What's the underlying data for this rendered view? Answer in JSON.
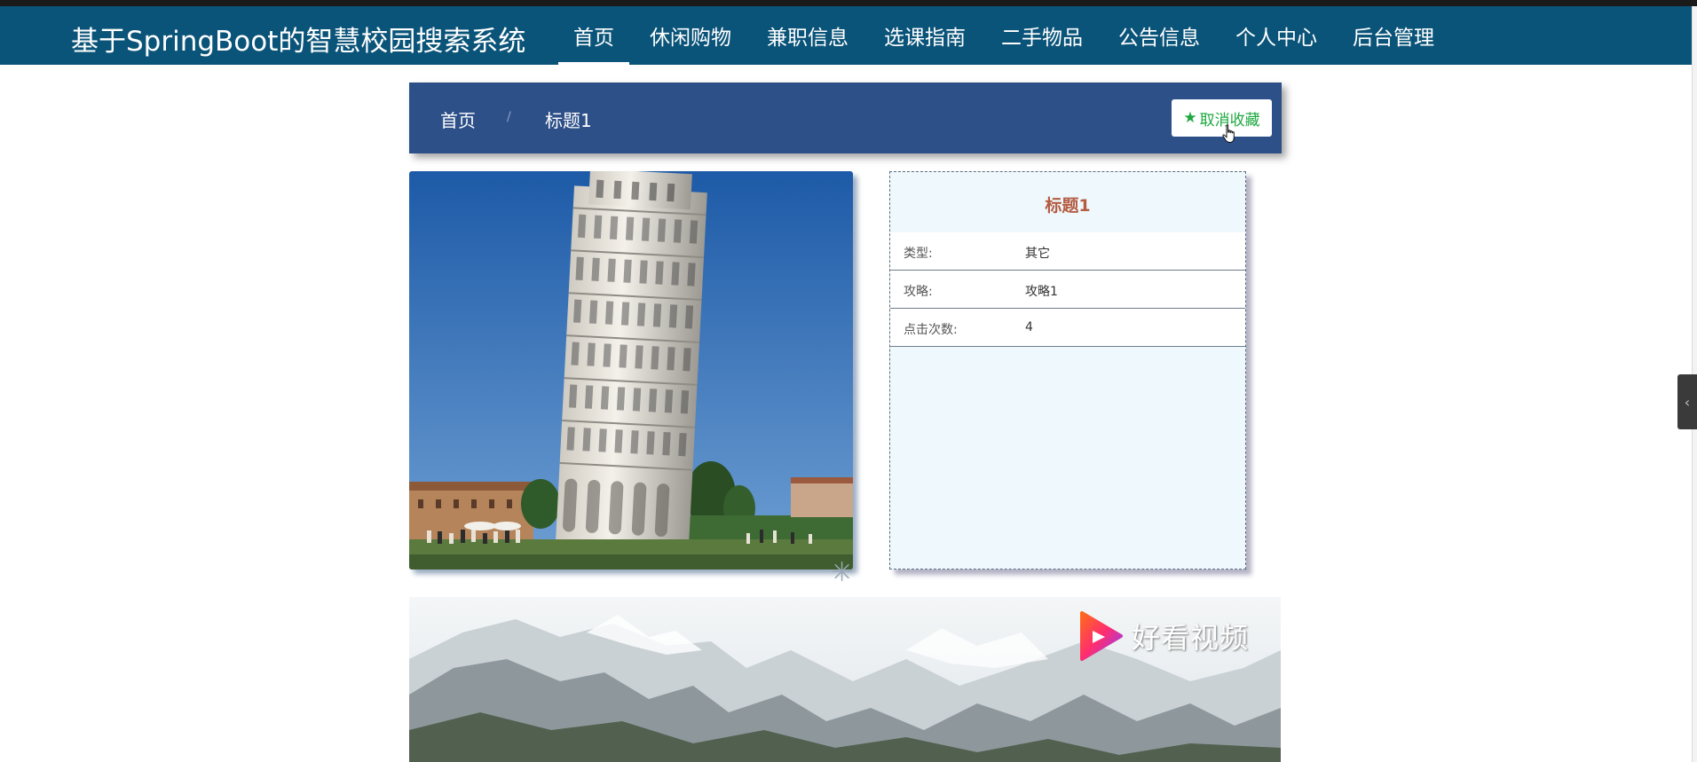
{
  "header": {
    "site_title": "基于SpringBoot的智慧校园搜索系统",
    "nav": [
      {
        "label": "首页",
        "active": true
      },
      {
        "label": "休闲购物",
        "active": false
      },
      {
        "label": "兼职信息",
        "active": false
      },
      {
        "label": "选课指南",
        "active": false
      },
      {
        "label": "二手物品",
        "active": false
      },
      {
        "label": "公告信息",
        "active": false
      },
      {
        "label": "个人中心",
        "active": false
      },
      {
        "label": "后台管理",
        "active": false
      }
    ]
  },
  "breadcrumb": {
    "home": "首页",
    "separator": "/",
    "current": "标题1",
    "favorite_button": "取消收藏",
    "favorite_icon": "star-icon"
  },
  "detail": {
    "title": "标题1",
    "rows": [
      {
        "label": "类型:",
        "value": "其它"
      },
      {
        "label": "攻略:",
        "value": "攻略1"
      },
      {
        "label": "点击次数:",
        "value": "4"
      }
    ]
  },
  "video": {
    "logo_text": "好看视频"
  },
  "side_tab_icon": "chevron-left-icon",
  "colors": {
    "navbar": "#0b5479",
    "breadcrumb_bar": "#2e5089",
    "favorite_text": "#1da83f",
    "detail_title": "#b55d43"
  }
}
